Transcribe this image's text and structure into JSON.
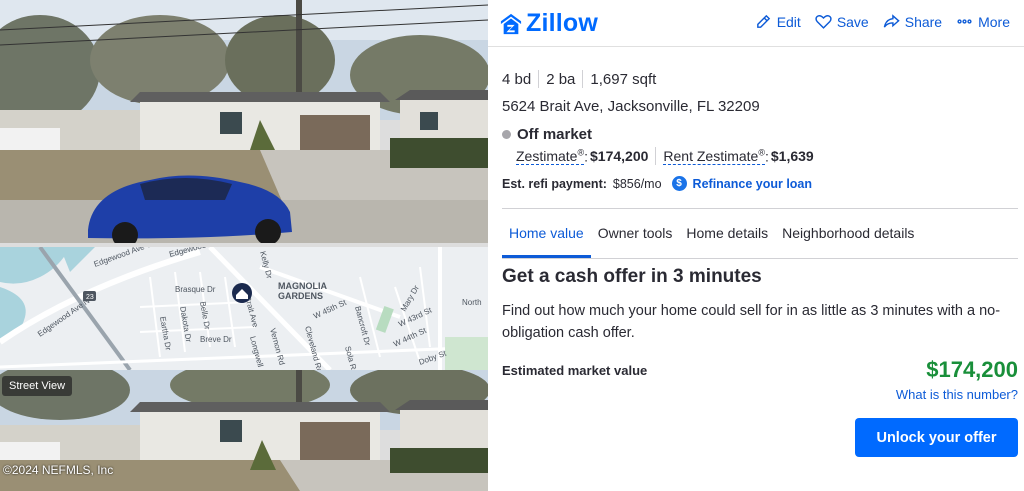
{
  "brand": {
    "name": "Zillow",
    "color": "#006aff"
  },
  "header_actions": [
    {
      "label": "Edit",
      "icon": "pencil-icon"
    },
    {
      "label": "Save",
      "icon": "heart-icon"
    },
    {
      "label": "Share",
      "icon": "share-icon"
    },
    {
      "label": "More",
      "icon": "more-dots-icon"
    }
  ],
  "media": {
    "street_view_label": "Street View",
    "copyright": "©2024 NEFMLS, Inc",
    "map_labels": [
      "Edgewood Ave W",
      "Edgewood Ave W",
      "Edgewood Ave N",
      "MAGNOLIA",
      "GARDENS",
      "W 45th St",
      "Cleveland Rd",
      "Vernon Rd",
      "Brasque Dr",
      "Belle Dr",
      "Dakota Dr",
      "Eartha Dr",
      "Breve Dr",
      "Brait Ave",
      "Kelly Dr",
      "Longwell",
      "Sola Rd",
      "Bancroft Dr",
      "W 43rd St",
      "W 44th St",
      "Mary Dr",
      "Doby St",
      "North",
      "23"
    ]
  },
  "facts": {
    "beds": "4 bd",
    "baths": "2 ba",
    "sqft": "1,697 sqft"
  },
  "address": "5624 Brait Ave, Jacksonville, FL 32209",
  "status": "Off market",
  "zestimate": {
    "label": "Zestimate",
    "mark": "®",
    "value": "$174,200"
  },
  "rent_zestimate": {
    "label": "Rent Zestimate",
    "mark": "®",
    "value": "$1,639"
  },
  "refi": {
    "label": "Est. refi payment:",
    "value": "$856/mo",
    "icon": "$",
    "link": "Refinance your loan"
  },
  "tabs": [
    {
      "label": "Home value",
      "active": true
    },
    {
      "label": "Owner tools",
      "active": false
    },
    {
      "label": "Home details",
      "active": false
    },
    {
      "label": "Neighborhood details",
      "active": false
    }
  ],
  "cash_offer": {
    "title": "Get a cash offer in 3 minutes",
    "description": "Find out how much your home could sell for in as little as 3 minutes with a no-obligation cash offer."
  },
  "market_value": {
    "label": "Estimated market value",
    "value": "$174,200",
    "help_link": "What is this number?",
    "value_color": "#198f3a"
  },
  "cta": {
    "label": "Unlock your offer"
  }
}
